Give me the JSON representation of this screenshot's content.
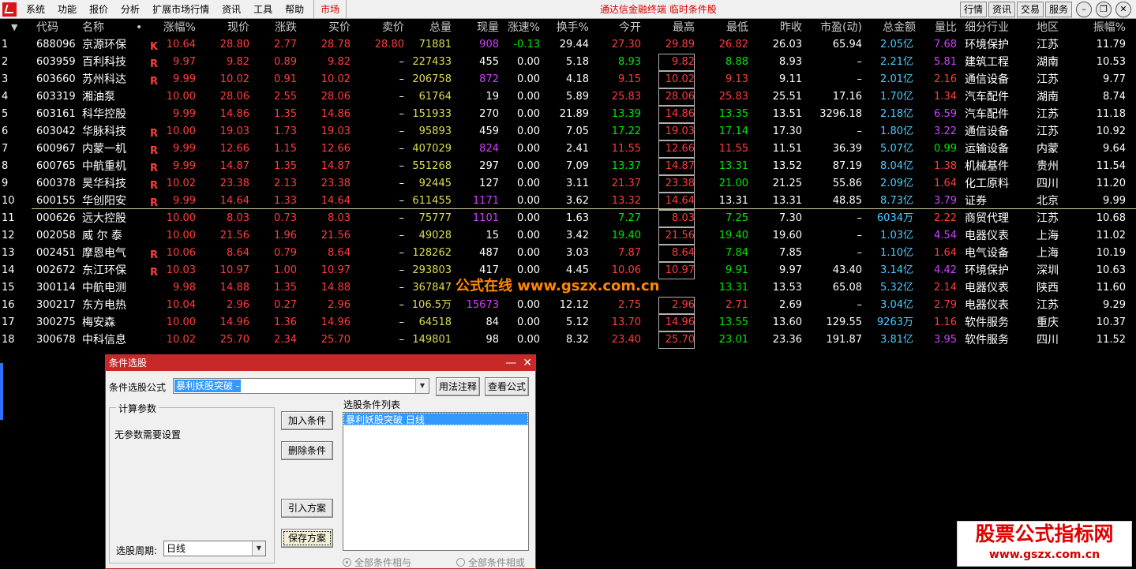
{
  "menu": {
    "items": [
      "系统",
      "功能",
      "报价",
      "分析",
      "扩展市场行情",
      "资讯",
      "工具",
      "帮助"
    ],
    "market": "市场",
    "title": "通达信金融终端  临时条件股",
    "right_buttons": [
      "行情",
      "资讯",
      "交易",
      "服务"
    ],
    "window_buttons": [
      "–",
      "❐",
      "✕"
    ]
  },
  "table": {
    "sort_glyph": "▼",
    "headers": [
      "代码",
      "名称",
      "•",
      "涨幅%",
      "现价",
      "涨跌",
      "买价",
      "卖价",
      "总量",
      "现量",
      "涨速%",
      "换手%",
      "今开",
      "最高",
      "最低",
      "昨收",
      "市盈(动)",
      "总金额",
      "量比",
      "细分行业",
      "地区",
      "振幅%"
    ],
    "rows": [
      {
        "n": "1",
        "code": "688096",
        "name": "京源环保",
        "flag": "K",
        "chg": "10.64",
        "price": "28.80",
        "diff": "2.77",
        "bid": "28.78",
        "ask": "28.80",
        "vol": "71881",
        "cur": "908",
        "speed": "-0.13",
        "turn": "29.44",
        "open": "27.30",
        "high": "29.89",
        "low": "26.82",
        "prev": "26.03",
        "pe": "65.94",
        "amt": "2.05",
        "unit": "亿",
        "ratio": "7.68",
        "ind": "环境保护",
        "reg": "江苏",
        "amp": "11.79"
      },
      {
        "n": "2",
        "code": "603959",
        "name": "百利科技",
        "flag": "R",
        "chg": "9.97",
        "price": "9.82",
        "diff": "0.89",
        "bid": "9.82",
        "ask": "–",
        "vol": "227433",
        "cur": "455",
        "speed": "0.00",
        "turn": "5.18",
        "open": "8.93",
        "high": "9.82",
        "low": "8.88",
        "prev": "8.93",
        "pe": "–",
        "amt": "2.21",
        "unit": "亿",
        "ratio": "5.81",
        "ind": "建筑工程",
        "reg": "湖南",
        "amp": "10.53"
      },
      {
        "n": "3",
        "code": "603660",
        "name": "苏州科达",
        "flag": "R",
        "chg": "9.99",
        "price": "10.02",
        "diff": "0.91",
        "bid": "10.02",
        "ask": "–",
        "vol": "206758",
        "cur": "872",
        "speed": "0.00",
        "turn": "4.18",
        "open": "9.15",
        "high": "10.02",
        "low": "9.13",
        "prev": "9.11",
        "pe": "–",
        "amt": "2.01",
        "unit": "亿",
        "ratio": "2.16",
        "ind": "通信设备",
        "reg": "江苏",
        "amp": "9.77"
      },
      {
        "n": "4",
        "code": "603319",
        "name": "湘油泵",
        "flag": "",
        "chg": "10.00",
        "price": "28.06",
        "diff": "2.55",
        "bid": "28.06",
        "ask": "–",
        "vol": "61764",
        "cur": "19",
        "speed": "0.00",
        "turn": "5.89",
        "open": "25.83",
        "high": "28.06",
        "low": "25.83",
        "prev": "25.51",
        "pe": "17.16",
        "amt": "1.70",
        "unit": "亿",
        "ratio": "1.34",
        "ind": "汽车配件",
        "reg": "湖南",
        "amp": "8.74"
      },
      {
        "n": "5",
        "code": "603161",
        "name": "科华控股",
        "flag": "",
        "chg": "9.99",
        "price": "14.86",
        "diff": "1.35",
        "bid": "14.86",
        "ask": "–",
        "vol": "151933",
        "cur": "270",
        "speed": "0.00",
        "turn": "21.89",
        "open": "13.39",
        "high": "14.86",
        "low": "13.35",
        "prev": "13.51",
        "pe": "3296.18",
        "amt": "2.18",
        "unit": "亿",
        "ratio": "6.59",
        "ind": "汽车配件",
        "reg": "江苏",
        "amp": "11.18"
      },
      {
        "n": "6",
        "code": "603042",
        "name": "华脉科技",
        "flag": "R",
        "chg": "10.00",
        "price": "19.03",
        "diff": "1.73",
        "bid": "19.03",
        "ask": "–",
        "vol": "95893",
        "cur": "459",
        "speed": "0.00",
        "turn": "7.05",
        "open": "17.22",
        "high": "19.03",
        "low": "17.14",
        "prev": "17.30",
        "pe": "–",
        "amt": "1.80",
        "unit": "亿",
        "ratio": "3.22",
        "ind": "通信设备",
        "reg": "江苏",
        "amp": "10.92"
      },
      {
        "n": "7",
        "code": "600967",
        "name": "内蒙一机",
        "flag": "R",
        "chg": "9.99",
        "price": "12.66",
        "diff": "1.15",
        "bid": "12.66",
        "ask": "–",
        "vol": "407029",
        "cur": "824",
        "speed": "0.00",
        "turn": "2.41",
        "open": "11.55",
        "high": "12.66",
        "low": "11.55",
        "prev": "11.51",
        "pe": "36.39",
        "amt": "5.07",
        "unit": "亿",
        "ratio": "0.99",
        "ind": "运输设备",
        "reg": "内蒙",
        "amp": "9.64"
      },
      {
        "n": "8",
        "code": "600765",
        "name": "中航重机",
        "flag": "R",
        "chg": "9.99",
        "price": "14.87",
        "diff": "1.35",
        "bid": "14.87",
        "ask": "–",
        "vol": "551268",
        "cur": "297",
        "speed": "0.00",
        "turn": "7.09",
        "open": "13.37",
        "high": "14.87",
        "low": "13.31",
        "prev": "13.52",
        "pe": "87.19",
        "amt": "8.04",
        "unit": "亿",
        "ratio": "1.38",
        "ind": "机械基件",
        "reg": "贵州",
        "amp": "11.54"
      },
      {
        "n": "9",
        "code": "600378",
        "name": "昊华科技",
        "flag": "R",
        "chg": "10.02",
        "price": "23.38",
        "diff": "2.13",
        "bid": "23.38",
        "ask": "–",
        "vol": "92445",
        "cur": "127",
        "speed": "0.00",
        "turn": "3.11",
        "open": "21.37",
        "high": "23.38",
        "low": "21.00",
        "prev": "21.25",
        "pe": "55.86",
        "amt": "2.09",
        "unit": "亿",
        "ratio": "1.64",
        "ind": "化工原料",
        "reg": "四川",
        "amp": "11.20"
      },
      {
        "n": "10",
        "code": "600155",
        "name": "华创阳安",
        "flag": "R",
        "chg": "9.99",
        "price": "14.64",
        "diff": "1.33",
        "bid": "14.64",
        "ask": "–",
        "vol": "611455",
        "cur": "1171",
        "speed": "0.00",
        "turn": "3.62",
        "open": "13.32",
        "high": "14.64",
        "low": "13.31",
        "prev": "13.31",
        "pe": "48.85",
        "amt": "8.73",
        "unit": "亿",
        "ratio": "3.79",
        "ind": "证券",
        "reg": "北京",
        "amp": "9.99"
      },
      {
        "n": "11",
        "code": "000626",
        "name": "远大控股",
        "flag": "",
        "chg": "10.00",
        "price": "8.03",
        "diff": "0.73",
        "bid": "8.03",
        "ask": "–",
        "vol": "75777",
        "cur": "1101",
        "speed": "0.00",
        "turn": "1.63",
        "open": "7.27",
        "high": "8.03",
        "low": "7.25",
        "prev": "7.30",
        "pe": "–",
        "amt": "6034",
        "unit": "万",
        "ratio": "2.22",
        "ind": "商贸代理",
        "reg": "江苏",
        "amp": "10.68"
      },
      {
        "n": "12",
        "code": "002058",
        "name": "威 尔 泰",
        "flag": "",
        "chg": "10.00",
        "price": "21.56",
        "diff": "1.96",
        "bid": "21.56",
        "ask": "–",
        "vol": "49028",
        "cur": "15",
        "speed": "0.00",
        "turn": "3.42",
        "open": "19.40",
        "high": "21.56",
        "low": "19.40",
        "prev": "19.60",
        "pe": "–",
        "amt": "1.03",
        "unit": "亿",
        "ratio": "4.54",
        "ind": "电器仪表",
        "reg": "上海",
        "amp": "11.02"
      },
      {
        "n": "13",
        "code": "002451",
        "name": "摩恩电气",
        "flag": "R",
        "chg": "10.06",
        "price": "8.64",
        "diff": "0.79",
        "bid": "8.64",
        "ask": "–",
        "vol": "128262",
        "cur": "487",
        "speed": "0.00",
        "turn": "3.03",
        "open": "7.87",
        "high": "8.64",
        "low": "7.84",
        "prev": "7.85",
        "pe": "–",
        "amt": "1.10",
        "unit": "亿",
        "ratio": "1.64",
        "ind": "电气设备",
        "reg": "上海",
        "amp": "10.19"
      },
      {
        "n": "14",
        "code": "002672",
        "name": "东江环保",
        "flag": "R",
        "chg": "10.03",
        "price": "10.97",
        "diff": "1.00",
        "bid": "10.97",
        "ask": "–",
        "vol": "293803",
        "cur": "417",
        "speed": "0.00",
        "turn": "4.45",
        "open": "10.06",
        "high": "10.97",
        "low": "9.91",
        "prev": "9.97",
        "pe": "43.40",
        "amt": "3.14",
        "unit": "亿",
        "ratio": "4.42",
        "ind": "环境保护",
        "reg": "深圳",
        "amp": "10.63"
      },
      {
        "n": "15",
        "code": "300114",
        "name": "中航电测",
        "flag": "",
        "chg": "9.98",
        "price": "14.88",
        "diff": "1.35",
        "bid": "14.88",
        "ask": "–",
        "vol": "367847",
        "cur": "",
        "speed": "",
        "turn": "",
        "open": "",
        "high": "",
        "low": "13.31",
        "prev": "13.53",
        "pe": "65.08",
        "amt": "5.32",
        "unit": "亿",
        "ratio": "2.14",
        "ind": "电器仪表",
        "reg": "陕西",
        "amp": "11.60"
      },
      {
        "n": "16",
        "code": "300217",
        "name": "东方电热",
        "flag": "",
        "chg": "10.04",
        "price": "2.96",
        "diff": "0.27",
        "bid": "2.96",
        "ask": "–",
        "vol": "106.5万",
        "cur": "15673",
        "speed": "0.00",
        "turn": "12.12",
        "open": "2.75",
        "high": "2.96",
        "low": "2.71",
        "prev": "2.69",
        "pe": "–",
        "amt": "3.04",
        "unit": "亿",
        "ratio": "2.79",
        "ind": "电器仪表",
        "reg": "江苏",
        "amp": "9.29"
      },
      {
        "n": "17",
        "code": "300275",
        "name": "梅安森",
        "flag": "",
        "chg": "10.00",
        "price": "14.96",
        "diff": "1.36",
        "bid": "14.96",
        "ask": "–",
        "vol": "64518",
        "cur": "84",
        "speed": "0.00",
        "turn": "5.12",
        "open": "13.70",
        "high": "14.96",
        "low": "13.55",
        "prev": "13.60",
        "pe": "129.55",
        "amt": "9263",
        "unit": "万",
        "ratio": "1.16",
        "ind": "软件服务",
        "reg": "重庆",
        "amp": "10.37"
      },
      {
        "n": "18",
        "code": "300678",
        "name": "中科信息",
        "flag": "",
        "chg": "10.02",
        "price": "25.70",
        "diff": "2.34",
        "bid": "25.70",
        "ask": "–",
        "vol": "149801",
        "cur": "98",
        "speed": "0.00",
        "turn": "8.32",
        "open": "23.40",
        "high": "25.70",
        "low": "23.01",
        "prev": "23.36",
        "pe": "191.87",
        "amt": "3.81",
        "unit": "亿",
        "ratio": "3.95",
        "ind": "软件服务",
        "reg": "四川",
        "amp": "11.52"
      }
    ]
  },
  "dialog": {
    "title": "条件选股",
    "formula_label": "条件选股公式",
    "formula_value": "暴利妖股突破 -",
    "usage_button": "用法注释",
    "view_button": "查看公式",
    "params_legend": "计算参数",
    "params_text": "无参数需要设置",
    "add_button": "加入条件",
    "delete_button": "删除条件",
    "import_button": "引入方案",
    "save_button": "保存方案",
    "list_label": "选股条件列表",
    "list_items": [
      "暴利妖股突破  日线"
    ],
    "period_label": "选股周期:",
    "period_value": "日线",
    "radio_and": "全部条件相与",
    "radio_or": "全部条件相或"
  },
  "watermarks": {
    "center": "公式在线 www.gszx.com.cn",
    "brand_big": "股票公式指标网",
    "brand_small": "www.gszx.com.cn"
  },
  "colors": {
    "up": "#ff3c3c",
    "down": "#00e600",
    "volume": "#dcdc50",
    "amount": "#4ecbff",
    "hot": "#d040ff",
    "dialog_title": "#c82828"
  }
}
